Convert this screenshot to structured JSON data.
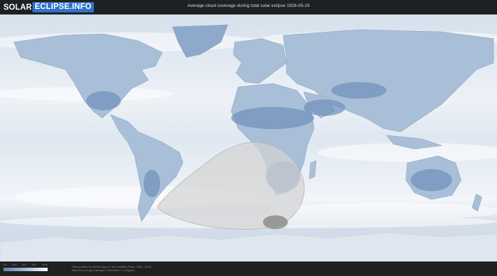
{
  "header": {
    "logo_part1": "SOLAR",
    "logo_part2": "ECLIPSE.INFO",
    "title": "Average cloud coverage during total solar eclipse 1928-05-19"
  },
  "map": {
    "projection": "equirectangular world map",
    "layer": "cloud coverage",
    "eclipse_region": "southern Atlantic Ocean, southern Africa and Antarctica"
  },
  "legend": {
    "ticks": [
      "0%",
      "25%",
      "50%",
      "75%",
      "100%"
    ],
    "colors": [
      "#5f82b0",
      "#8ea9cb",
      "#c2d2e5",
      "#ffffff"
    ]
  },
  "footer": {
    "credit_line1": "Data provided by NASA's Aqua & Terra satellite (Years: 2000 - 2019)",
    "credit_line2": "https://neo.sci.gsfc.nasa.gov | Resolution: 0.1 degrees"
  },
  "colors": {
    "background": "#1b1c1e",
    "ocean": "#e8eef5",
    "cloud_free": "#5f82b0",
    "brand": "#2f73c8"
  }
}
